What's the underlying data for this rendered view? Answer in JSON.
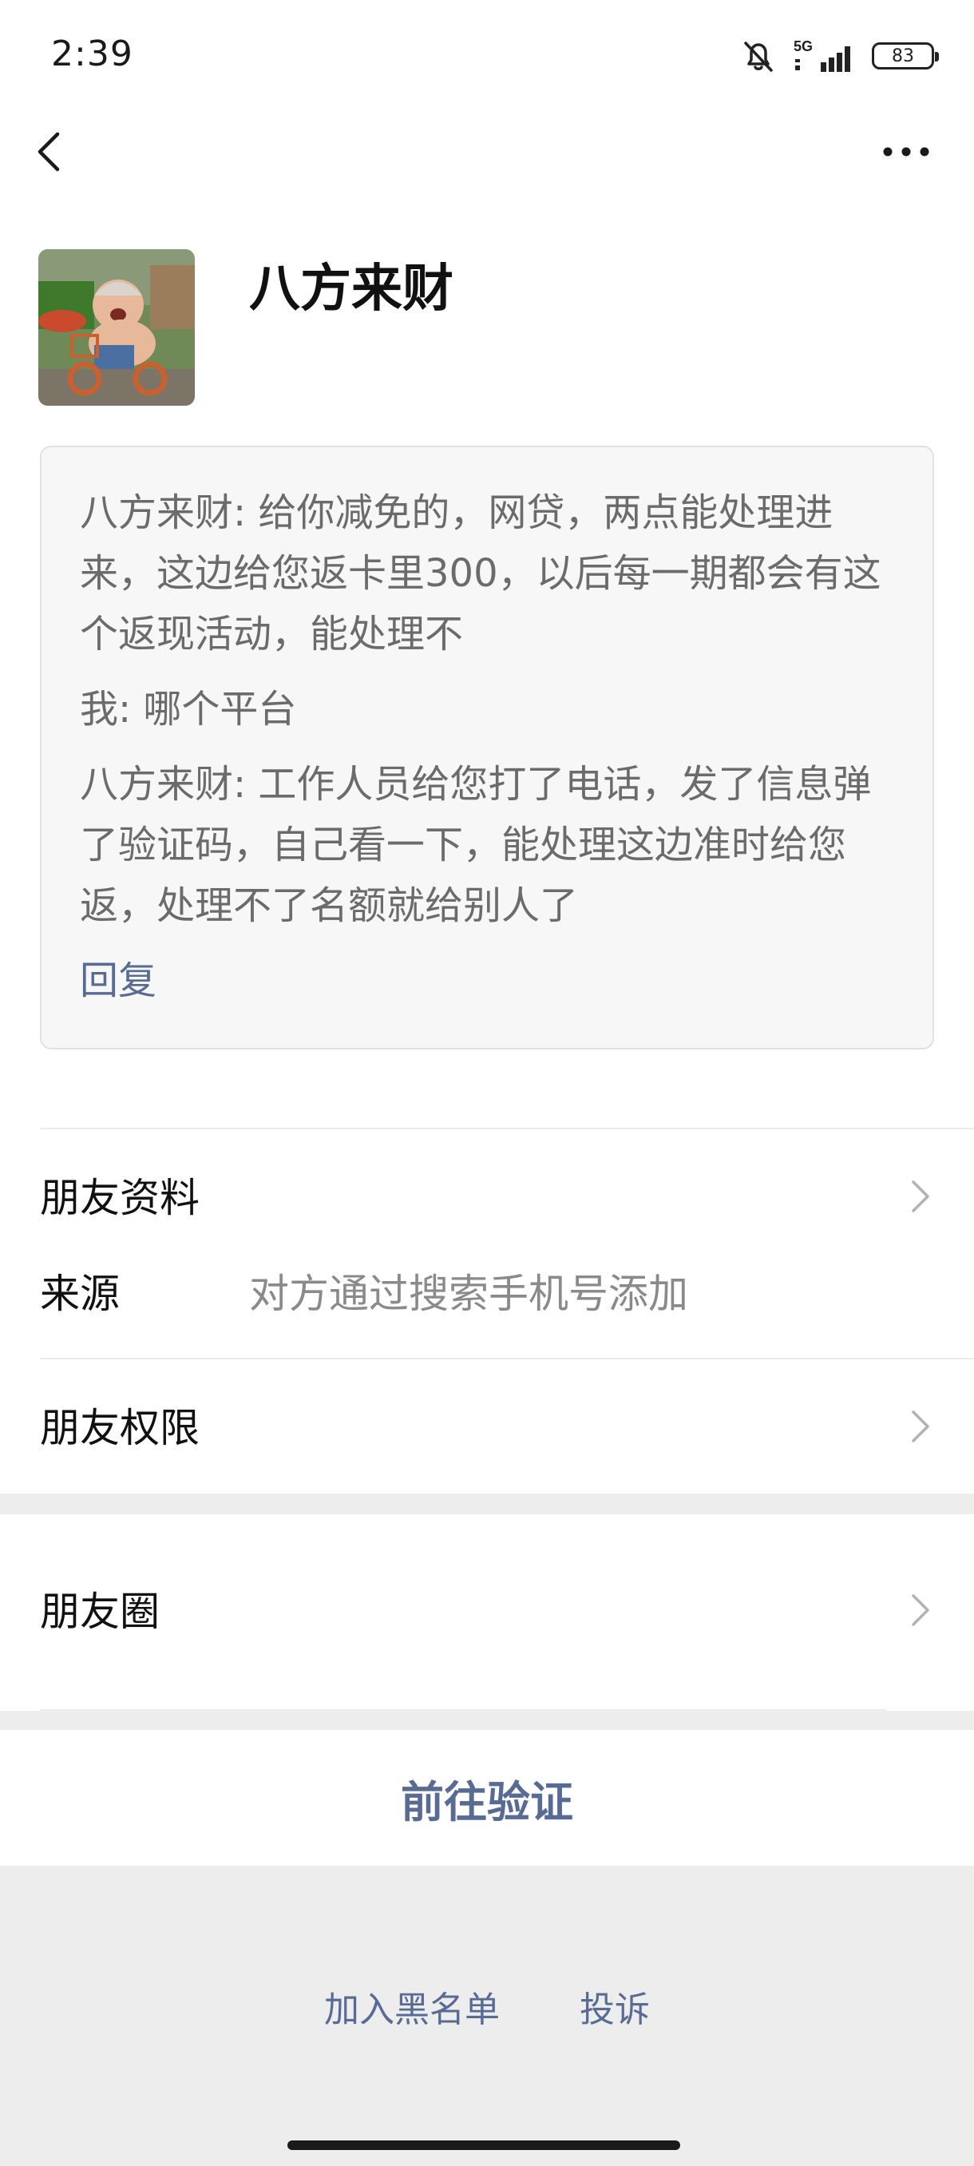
{
  "status_bar": {
    "time": "2:39",
    "network": "5G",
    "battery": "83"
  },
  "nav": {
    "back_icon": "chevron-left-icon",
    "more_icon": "more-dots-icon"
  },
  "profile": {
    "display_name": "八方来财"
  },
  "verification": {
    "messages": [
      "八方来财: 给你减免的，网贷，两点能处理进来，这边给您返卡里300，以后每一期都会有这个返现活动，能处理不",
      "我: 哪个平台",
      "八方来财: 工作人员给您打了电话，发了信息弹了验证码，自己看一下，能处理这边准时给您返，处理不了名额就给别人了"
    ],
    "reply_label": "回复"
  },
  "rows": {
    "friend_info": "朋友资料",
    "source_label": "来源",
    "source_value": "对方通过搜索手机号添加",
    "friend_permissions": "朋友权限",
    "moments": "朋友圈"
  },
  "actions": {
    "verify": "前往验证",
    "blacklist": "加入黑名单",
    "report": "投诉"
  },
  "colors": {
    "link": "#576b95",
    "divider": "#ececec",
    "band": "#ededed"
  }
}
